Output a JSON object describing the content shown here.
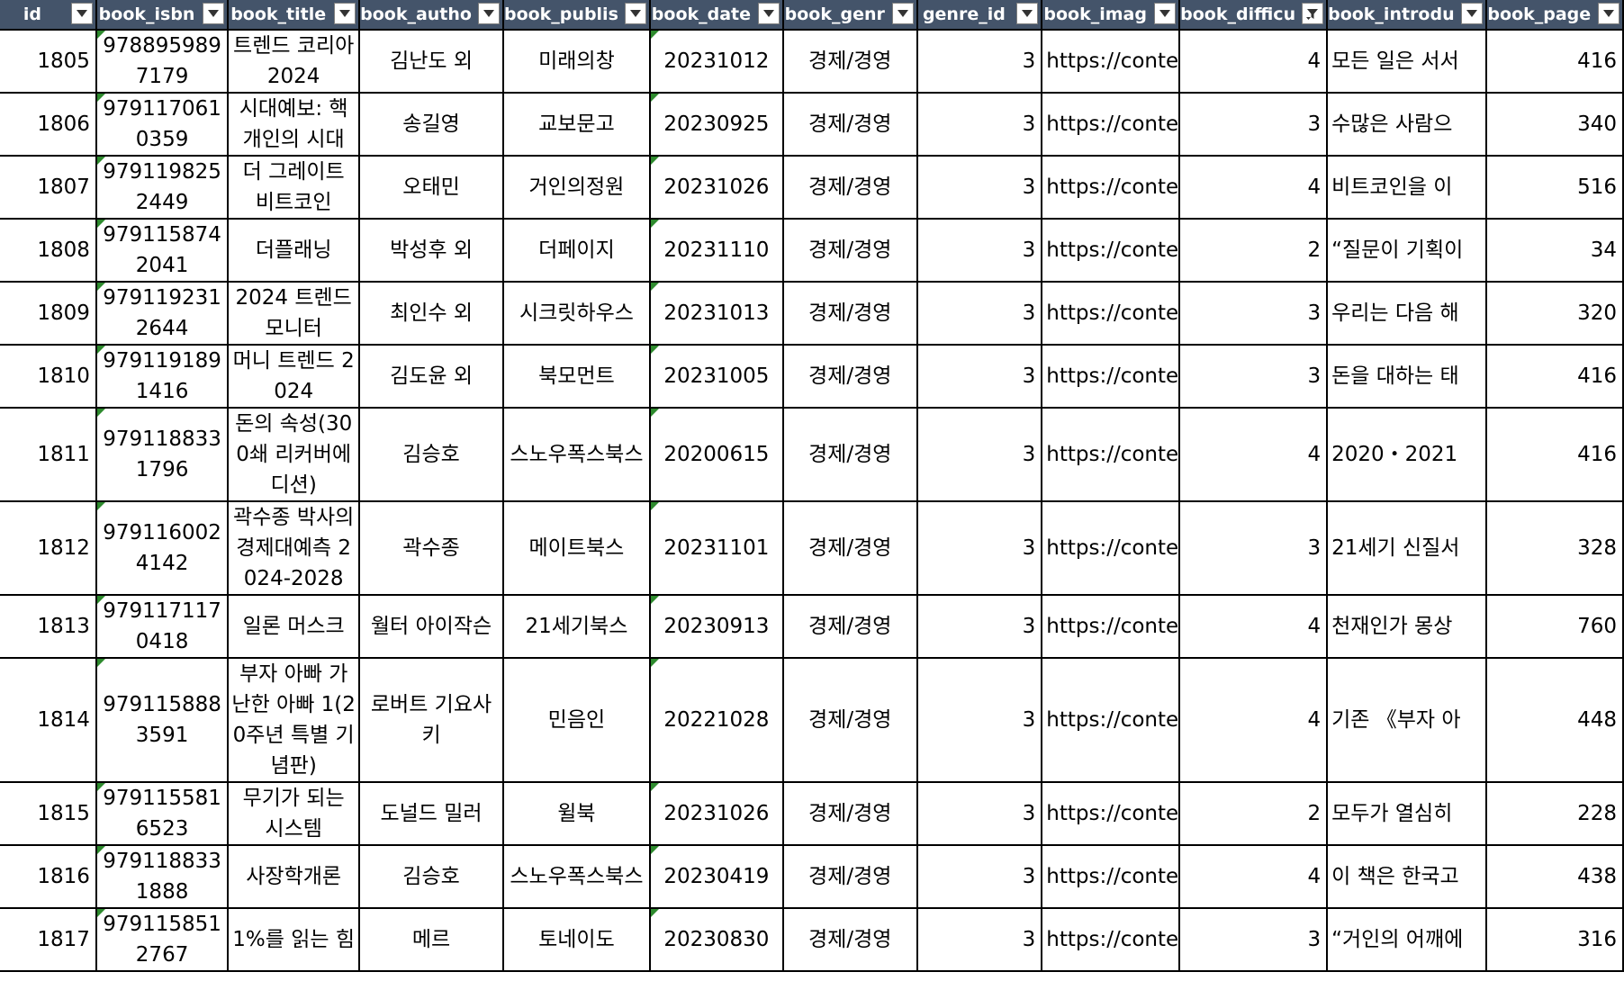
{
  "columns": [
    {
      "key": "id",
      "label": "id",
      "filter": "arrow"
    },
    {
      "key": "book_isbn",
      "label": "book_isbn",
      "filter": "arrow"
    },
    {
      "key": "book_title",
      "label": "book_title",
      "filter": "arrow"
    },
    {
      "key": "book_author",
      "label": "book_autho",
      "filter": "arrow"
    },
    {
      "key": "book_publisher",
      "label": "book_publis",
      "filter": "arrow"
    },
    {
      "key": "book_date",
      "label": "book_date",
      "filter": "arrow"
    },
    {
      "key": "book_genre",
      "label": "book_genr",
      "filter": "arrow"
    },
    {
      "key": "genre_id",
      "label": "genre_id",
      "filter": "arrow"
    },
    {
      "key": "book_image",
      "label": "book_imag",
      "filter": "arrow"
    },
    {
      "key": "book_difficulty",
      "label": "book_difficu",
      "filter": "funnel"
    },
    {
      "key": "book_introduction",
      "label": "book_introdu",
      "filter": "arrow"
    },
    {
      "key": "book_page",
      "label": "book_page",
      "filter": "arrow"
    }
  ],
  "rows": [
    {
      "id": "1805",
      "isbn": "9788959897179",
      "title": "트렌드 코리아 2024",
      "author": "김난도 외",
      "publisher": "미래의창",
      "date": "20231012",
      "genre": "경제/경영",
      "genre_id": "3",
      "image": "https://conte",
      "difficulty": "4",
      "intro": "모든 일은 서서",
      "page": "416"
    },
    {
      "id": "1806",
      "isbn": "9791170610359",
      "title": "시대예보: 핵개인의 시대",
      "author": "송길영",
      "publisher": "교보문고",
      "date": "20230925",
      "genre": "경제/경영",
      "genre_id": "3",
      "image": "https://conte",
      "difficulty": "3",
      "intro": "수많은 사람으",
      "page": "340"
    },
    {
      "id": "1807",
      "isbn": "9791198252449",
      "title": "더 그레이트 비트코인",
      "author": "오태민",
      "publisher": "거인의정원",
      "date": "20231026",
      "genre": "경제/경영",
      "genre_id": "3",
      "image": "https://conte",
      "difficulty": "4",
      "intro": "비트코인을 이",
      "page": "516"
    },
    {
      "id": "1808",
      "isbn": "9791158742041",
      "title": "더플래닝",
      "author": "박성후 외",
      "publisher": "더페이지",
      "date": "20231110",
      "genre": "경제/경영",
      "genre_id": "3",
      "image": "https://conte",
      "difficulty": "2",
      "intro": "“질문이 기획이",
      "page": "34"
    },
    {
      "id": "1809",
      "isbn": "9791192312644",
      "title": "2024 트렌드 모니터",
      "author": "최인수 외",
      "publisher": "시크릿하우스",
      "date": "20231013",
      "genre": "경제/경영",
      "genre_id": "3",
      "image": "https://conte",
      "difficulty": "3",
      "intro": "우리는 다음 해",
      "page": "320"
    },
    {
      "id": "1810",
      "isbn": "9791191891416",
      "title": "머니 트렌드 2024",
      "author": "김도윤 외",
      "publisher": "북모먼트",
      "date": "20231005",
      "genre": "경제/경영",
      "genre_id": "3",
      "image": "https://conte",
      "difficulty": "3",
      "intro": "돈을 대하는 태",
      "page": "416"
    },
    {
      "id": "1811",
      "isbn": "9791188331796",
      "title": "돈의 속성(300쇄 리커버에디션)",
      "author": "김승호",
      "publisher": "스노우폭스북스",
      "date": "20200615",
      "genre": "경제/경영",
      "genre_id": "3",
      "image": "https://conte",
      "difficulty": "4",
      "intro": "2020・2021",
      "page": "416"
    },
    {
      "id": "1812",
      "isbn": "9791160024142",
      "title": "곽수종 박사의 경제대예측 2024-2028",
      "author": "곽수종",
      "publisher": "메이트북스",
      "date": "20231101",
      "genre": "경제/경영",
      "genre_id": "3",
      "image": "https://conte",
      "difficulty": "3",
      "intro": "21세기 신질서",
      "page": "328"
    },
    {
      "id": "1813",
      "isbn": "9791171170418",
      "title": "일론 머스크",
      "author": "월터 아이작슨",
      "publisher": "21세기북스",
      "date": "20230913",
      "genre": "경제/경영",
      "genre_id": "3",
      "image": "https://conte",
      "difficulty": "4",
      "intro": "천재인가 몽상",
      "page": "760"
    },
    {
      "id": "1814",
      "isbn": "9791158883591",
      "title": "부자 아빠 가난한 아빠 1(20주년 특별 기념판)",
      "author": "로버트 기요사키",
      "publisher": "민음인",
      "date": "20221028",
      "genre": "경제/경영",
      "genre_id": "3",
      "image": "https://conte",
      "difficulty": "4",
      "intro": "기존 《부자 아",
      "page": "448"
    },
    {
      "id": "1815",
      "isbn": "9791155816523",
      "title": "무기가 되는 시스템",
      "author": "도널드 밀러",
      "publisher": "윌북",
      "date": "20231026",
      "genre": "경제/경영",
      "genre_id": "3",
      "image": "https://conte",
      "difficulty": "2",
      "intro": "모두가 열심히",
      "page": "228"
    },
    {
      "id": "1816",
      "isbn": "9791188331888",
      "title": "사장학개론",
      "author": "김승호",
      "publisher": "스노우폭스북스",
      "date": "20230419",
      "genre": "경제/경영",
      "genre_id": "3",
      "image": "https://conte",
      "difficulty": "4",
      "intro": "이 책은 한국고",
      "page": "438"
    },
    {
      "id": "1817",
      "isbn": "9791158512767",
      "title": "1%를 읽는 힘",
      "author": "메르",
      "publisher": "토네이도",
      "date": "20230830",
      "genre": "경제/경영",
      "genre_id": "3",
      "image": "https://conte",
      "difficulty": "3",
      "intro": "“거인의 어깨에",
      "page": "316"
    }
  ]
}
